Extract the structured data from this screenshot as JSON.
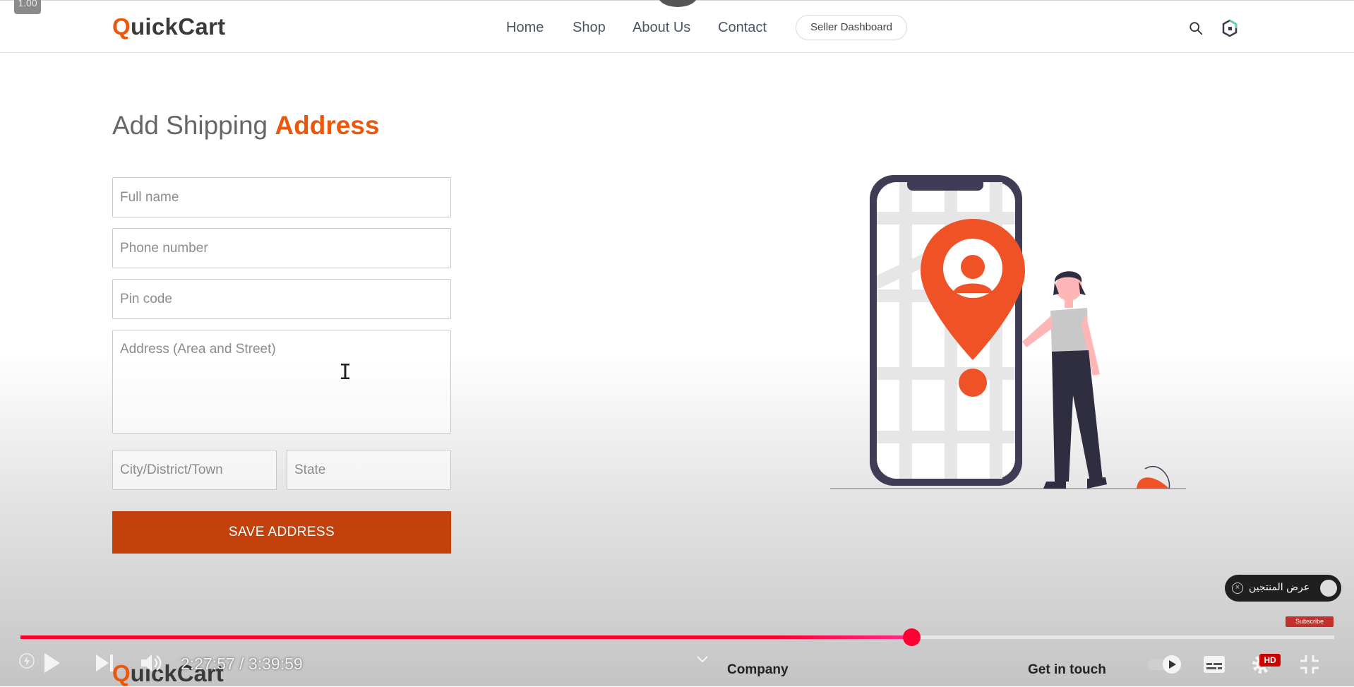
{
  "player": {
    "speed_badge": "1.00",
    "time_current": "2:27:57",
    "time_separator": " / ",
    "time_total": "3:39:59",
    "progress_fraction": 0.678,
    "hd_badge": "HD",
    "subscribe_label": "Subscribe"
  },
  "navbar": {
    "logo_first": "Q",
    "logo_rest": "uickCart",
    "links": [
      "Home",
      "Shop",
      "About Us",
      "Contact"
    ],
    "seller_button": "Seller Dashboard"
  },
  "form": {
    "heading_plain": "Add Shipping ",
    "heading_accent": "Address",
    "fullname_placeholder": "Full name",
    "phone_placeholder": "Phone number",
    "pincode_placeholder": "Pin code",
    "address_placeholder": "Address (Area and Street)",
    "city_placeholder": "City/District/Town",
    "state_placeholder": "State",
    "save_button": "SAVE ADDRESS"
  },
  "notification": {
    "label": "عرض المنتجين"
  },
  "footer": {
    "logo_first": "Q",
    "logo_rest": "uickCart",
    "company": "Company",
    "get_in_touch": "Get in touch"
  },
  "colors": {
    "accent": "#ea580c",
    "button": "#c2410c",
    "progress": "#ff0033"
  }
}
